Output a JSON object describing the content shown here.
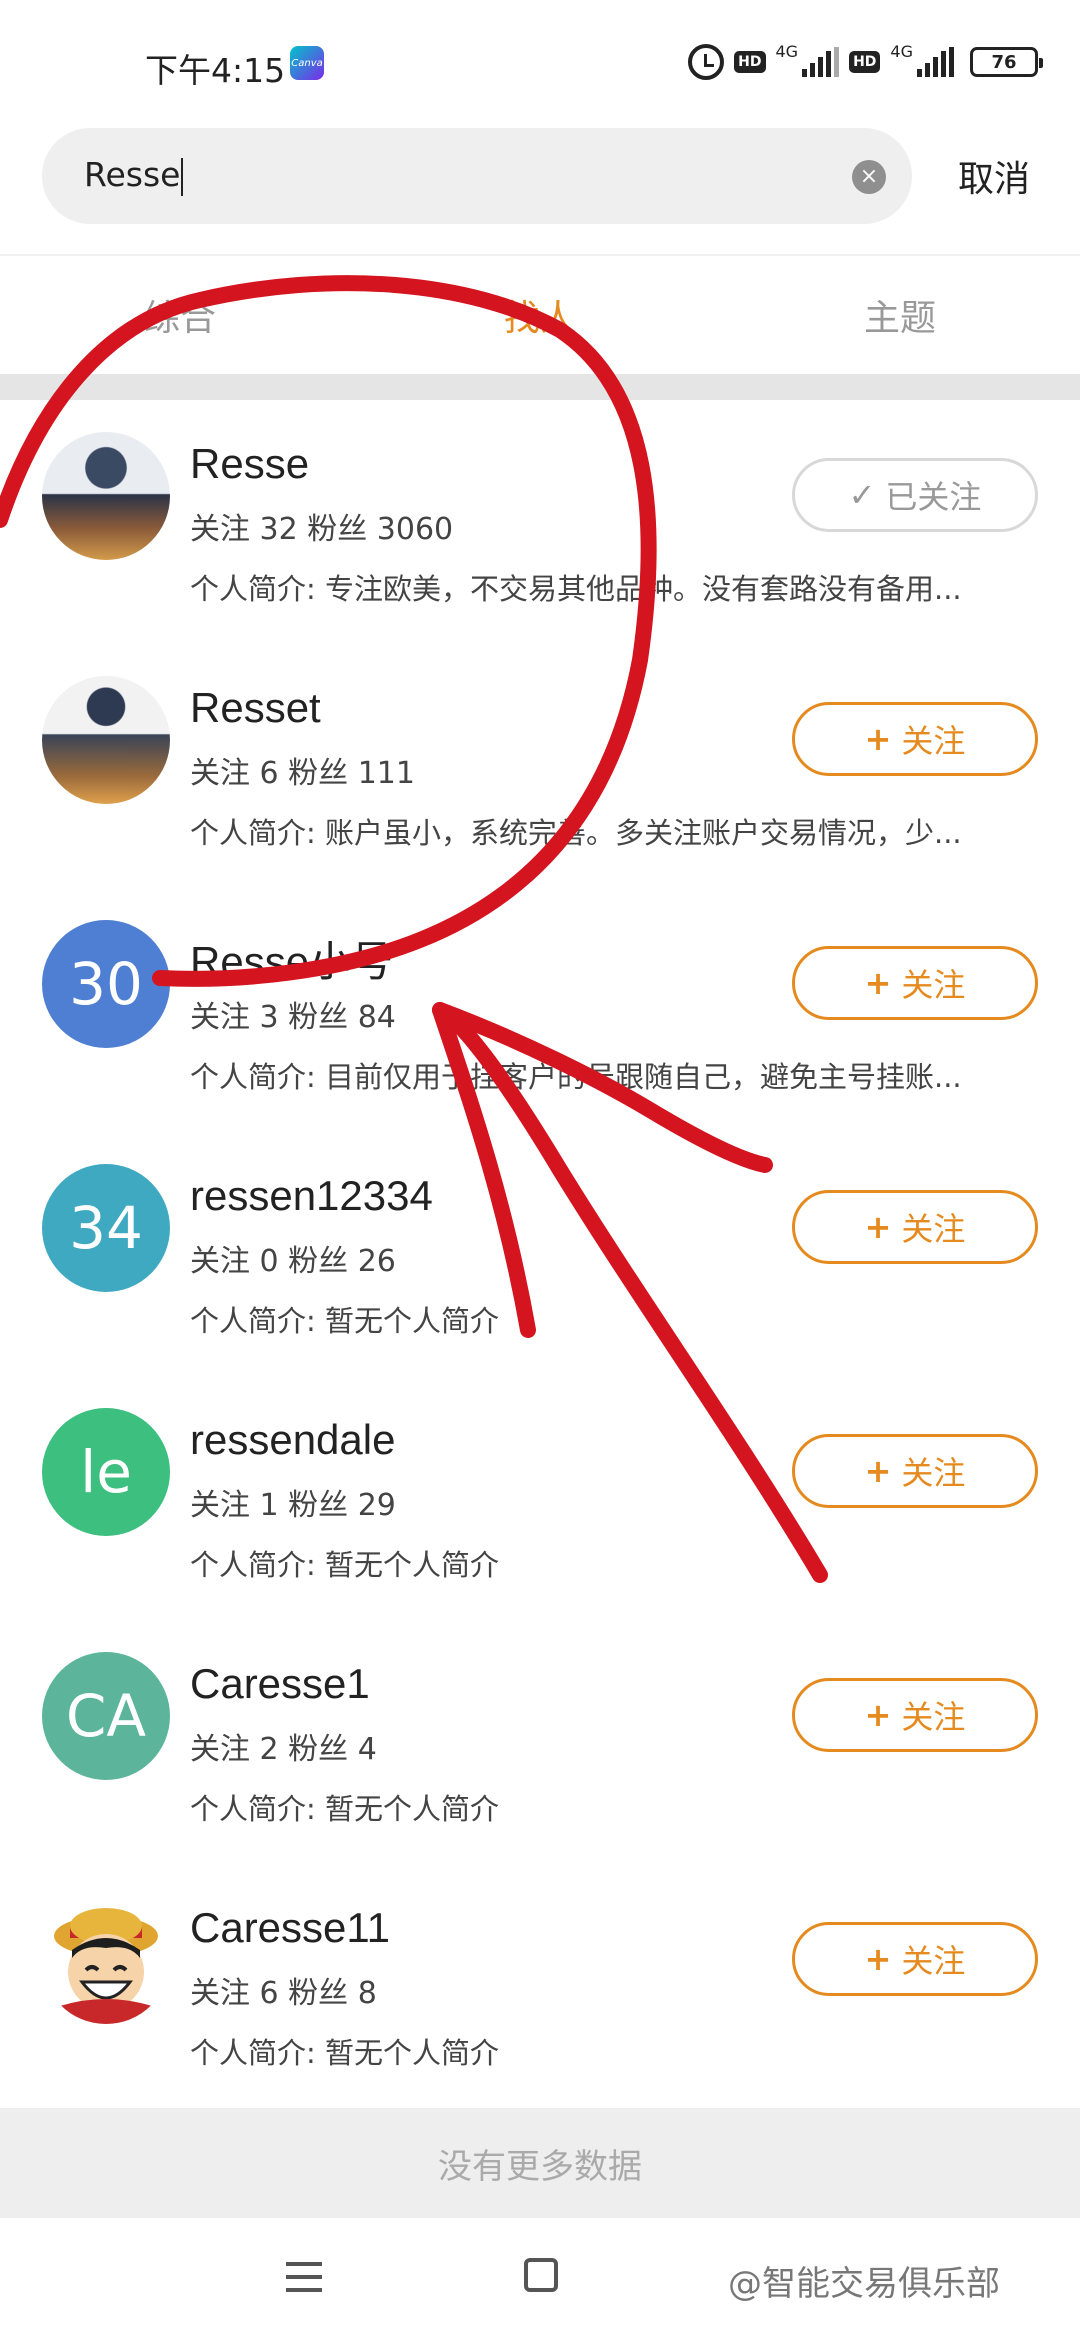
{
  "status_bar": {
    "time": "下午4:15",
    "canva_badge": "Canva",
    "hd1": "HD",
    "net1": "4G",
    "hd2": "HD",
    "net2": "4G",
    "battery": "76"
  },
  "search": {
    "query": "Resse",
    "cancel_label": "取消"
  },
  "tabs": [
    {
      "label": "综合",
      "active": false
    },
    {
      "label": "找人",
      "active": true
    },
    {
      "label": "主题",
      "active": false
    }
  ],
  "users": [
    {
      "name": "Resse",
      "stats": "关注 32 粉丝 3060",
      "bio": "个人简介: 专注欧美，不交易其他品种。没有套路没有备用...",
      "avatar_text": "",
      "button": "已关注",
      "button_glyph": "✓"
    },
    {
      "name": "Resset",
      "stats": "关注 6 粉丝 111",
      "bio": "个人简介: 账户虽小，系统完善。多关注账户交易情况，少...",
      "avatar_text": "",
      "button": "关注",
      "button_glyph": "+"
    },
    {
      "name": "Resse小号",
      "stats": "关注 3 粉丝 84",
      "bio": "个人简介: 目前仅用于挂客户的号跟随自己，避免主号挂账...",
      "avatar_text": "30",
      "button": "关注",
      "button_glyph": "+"
    },
    {
      "name": "ressen12334",
      "stats": "关注 0 粉丝 26",
      "bio": "个人简介: 暂无个人简介",
      "avatar_text": "34",
      "button": "关注",
      "button_glyph": "+"
    },
    {
      "name": "ressendale",
      "stats": "关注 1 粉丝 29",
      "bio": "个人简介: 暂无个人简介",
      "avatar_text": "le",
      "button": "关注",
      "button_glyph": "+"
    },
    {
      "name": "Caresse1",
      "stats": "关注 2 粉丝 4",
      "bio": "个人简介: 暂无个人简介",
      "avatar_text": "CA",
      "button": "关注",
      "button_glyph": "+"
    },
    {
      "name": "Caresse11",
      "stats": "关注 6 粉丝 8",
      "bio": "个人简介: 暂无个人简介",
      "avatar_text": "",
      "button": "关注",
      "button_glyph": "+"
    }
  ],
  "colors": {
    "accent": "#e58a1f",
    "avatar_30": "#4f7fd2",
    "avatar_34": "#3fa9c1",
    "avatar_le": "#3dbf7f",
    "avatar_ca": "#5cb59a",
    "marker": "#d4141f"
  },
  "footer": {
    "no_more": "没有更多数据",
    "watermark": "@智能交易俱乐部"
  }
}
